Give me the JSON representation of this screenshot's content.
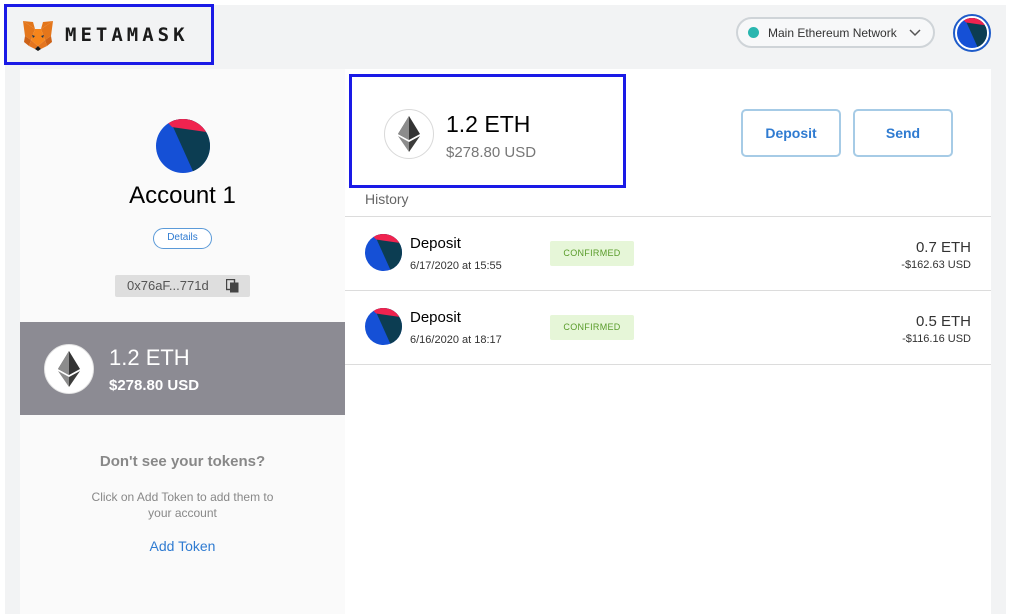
{
  "header": {
    "brand": "METAMASK",
    "network": "Main Ethereum Network",
    "network_status_color": "#29b6af"
  },
  "account": {
    "name": "Account 1",
    "details_label": "Details",
    "address": "0x76aF...771d"
  },
  "selected_token": {
    "amount": "1.2 ETH",
    "usd": "$278.80 USD"
  },
  "tokens_help": {
    "title": "Don't see your tokens?",
    "text": "Click on Add Token to add them to your account",
    "add_label": "Add Token"
  },
  "balance": {
    "amount": "1.2 ETH",
    "usd": "$278.80 USD"
  },
  "actions": {
    "deposit_label": "Deposit",
    "send_label": "Send"
  },
  "history": {
    "label": "History",
    "transactions": [
      {
        "title": "Deposit",
        "date": "6/17/2020 at 15:55",
        "status": "CONFIRMED",
        "eth": "0.7 ETH",
        "usd": "-$162.63 USD"
      },
      {
        "title": "Deposit",
        "date": "6/16/2020 at 18:17",
        "status": "CONFIRMED",
        "eth": "0.5 ETH",
        "usd": "-$116.16 USD"
      }
    ]
  },
  "colors": {
    "accent": "#2f7bd1",
    "selected_token_bg": "#8c8b93",
    "confirmed_bg": "#e6f6d8",
    "confirmed_text": "#5a9c2b"
  },
  "icons": {
    "logo": "metamask-fox-icon",
    "eth": "ethereum-icon",
    "copy": "copy-icon",
    "chevron": "chevron-down-icon"
  }
}
